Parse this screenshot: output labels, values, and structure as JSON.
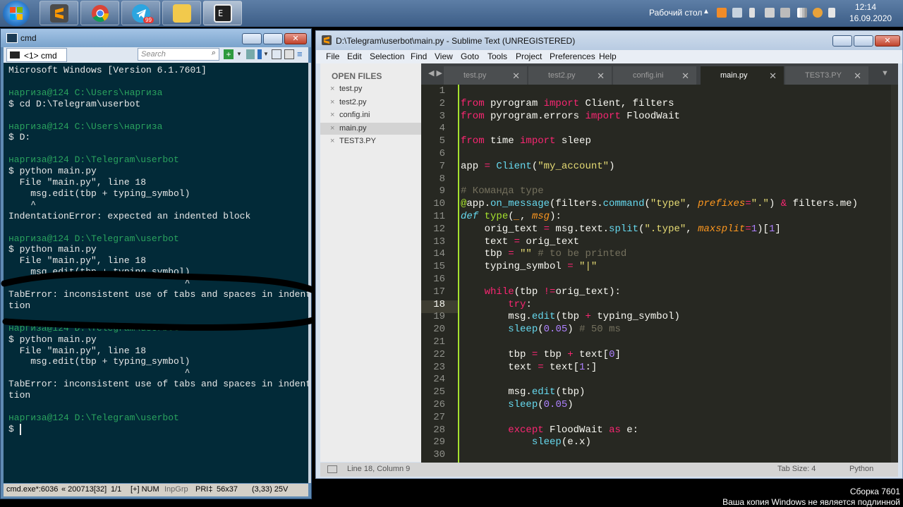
{
  "taskbar": {
    "apps": [
      "sublime-icon",
      "chrome-icon",
      "telegram-icon",
      "explorer-icon",
      "console-icon"
    ],
    "telegram_badge": "99",
    "desktop_label": "Рабочий стол",
    "time": "12:14",
    "date": "16.09.2020"
  },
  "cmd": {
    "title": "cmd",
    "tab_label": "<1> cmd",
    "search_placeholder": "Search",
    "lines": [
      {
        "t": "Microsoft Windows [Version 6.1.7601]",
        "p": false
      },
      {
        "t": "",
        "p": false
      },
      {
        "t": "наргиза@124 C:\\Users\\наргиза",
        "p": true
      },
      {
        "t": "$ cd D:\\Telegram\\userbot",
        "p": false
      },
      {
        "t": "",
        "p": false
      },
      {
        "t": "наргиза@124 C:\\Users\\наргиза",
        "p": true
      },
      {
        "t": "$ D:",
        "p": false
      },
      {
        "t": "",
        "p": false
      },
      {
        "t": "наргиза@124 D:\\Telegram\\userbot",
        "p": true
      },
      {
        "t": "$ python main.py",
        "p": false
      },
      {
        "t": "  File \"main.py\", line 18",
        "p": false
      },
      {
        "t": "    msg.edit(tbp + typing_symbol)",
        "p": false
      },
      {
        "t": "    ^",
        "p": false
      },
      {
        "t": "IndentationError: expected an indented block",
        "p": false
      },
      {
        "t": "",
        "p": false
      },
      {
        "t": "наргиза@124 D:\\Telegram\\userbot",
        "p": true
      },
      {
        "t": "$ python main.py",
        "p": false
      },
      {
        "t": "  File \"main.py\", line 18",
        "p": false
      },
      {
        "t": "    msg.edit(tbp + typing_symbol)",
        "p": false
      },
      {
        "t": "                                ^",
        "p": false
      },
      {
        "t": "TabError: inconsistent use of tabs and spaces in indenta",
        "p": false
      },
      {
        "t": "tion",
        "p": false
      },
      {
        "t": "",
        "p": false
      },
      {
        "t": "наргиза@124 D:\\Telegram\\userbot",
        "p": true
      },
      {
        "t": "$ python main.py",
        "p": false
      },
      {
        "t": "  File \"main.py\", line 18",
        "p": false
      },
      {
        "t": "    msg.edit(tbp + typing_symbol)",
        "p": false
      },
      {
        "t": "                                ^",
        "p": false
      },
      {
        "t": "TabError: inconsistent use of tabs and spaces in indenta",
        "p": false
      },
      {
        "t": "tion",
        "p": false
      },
      {
        "t": "",
        "p": false
      },
      {
        "t": "наргиза@124 D:\\Telegram\\userbot",
        "p": true
      },
      {
        "t": "$ ",
        "p": false
      }
    ],
    "status": {
      "proc": "cmd.exe*:6036",
      "build": "« 200713[32]",
      "pos": "1/1",
      "mode": "[+] NUM",
      "inp": "InpGrp",
      "pri": "PRI‡",
      "size": "56x37",
      "cursor": "(3,33) 25V"
    }
  },
  "sublime": {
    "title": "D:\\Telegram\\userbot\\main.py - Sublime Text (UNREGISTERED)",
    "menu": [
      "File",
      "Edit",
      "Selection",
      "Find",
      "View",
      "Goto",
      "Tools",
      "Project",
      "Preferences",
      "Help"
    ],
    "open_files_label": "OPEN FILES",
    "files": [
      "test.py",
      "test2.py",
      "config.ini",
      "main.py",
      "TEST3.PY"
    ],
    "tabs": [
      "test.py",
      "test2.py",
      "config.ini",
      "main.py",
      "TEST3.PY"
    ],
    "active_tab": 3,
    "current_line": 18,
    "status": {
      "position": "Line 18, Column 9",
      "tab_size": "Tab Size: 4",
      "syntax": "Python"
    }
  },
  "code_lines": [
    "1",
    "2",
    "3",
    "4",
    "5",
    "6",
    "7",
    "8",
    "9",
    "10",
    "11",
    "12",
    "13",
    "14",
    "15",
    "16",
    "17",
    "18",
    "19",
    "20",
    "21",
    "22",
    "23",
    "24",
    "25",
    "26",
    "27",
    "28",
    "29",
    "30"
  ],
  "watermark": {
    "line1": "Сборка 7601",
    "line2": "Ваша копия Windows не является подлинной"
  }
}
